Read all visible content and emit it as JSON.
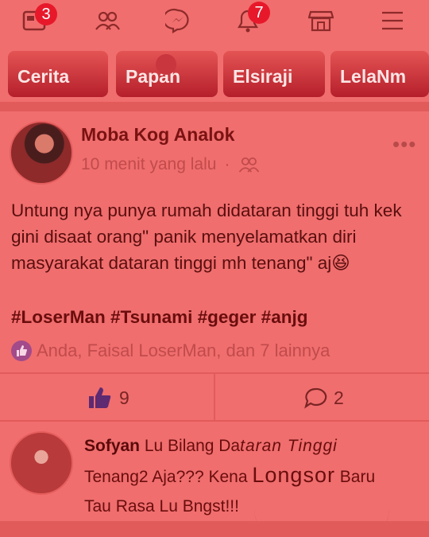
{
  "nav": {
    "items": [
      {
        "icon": "news-feed-icon",
        "badge": "3"
      },
      {
        "icon": "friends-icon",
        "badge": ""
      },
      {
        "icon": "messenger-icon",
        "badge": ""
      },
      {
        "icon": "bell-icon",
        "badge": "7"
      },
      {
        "icon": "marketplace-icon",
        "badge": ""
      },
      {
        "icon": "menu-icon",
        "badge": ""
      }
    ]
  },
  "stories": [
    {
      "label": "Cerita"
    },
    {
      "label": "Papah"
    },
    {
      "label": "Elsiraji"
    },
    {
      "label": "LelaNm"
    }
  ],
  "post": {
    "author": "Moba Kog Analok",
    "time": "10 menit yang lalu",
    "separator": "·",
    "privacy_icon": "friends-icon",
    "text": "Untung nya punya rumah didataran tinggi tuh kek gini disaat orang\" panik menyelamatkan diri masyarakat dataran tinggi mh tenang\" aj",
    "emoji": "😆",
    "hashtags": "#LoserMan #Tsunami #geger #anjg",
    "reactions_text": "Anda, Faisal LoserMan, dan 7 lainnya",
    "like_count": "9",
    "comment_count": "2"
  },
  "comment": {
    "author": "Sofyan",
    "text_parts": [
      "Lu Bilang Da",
      "taran Tinggi",
      "Tenang2 Aja??? Ke",
      "na",
      "Longsor",
      "Baru",
      "Tau Rasa Lu Bngst!!!"
    ]
  },
  "colors": {
    "background": "#f06e6e",
    "badge": "#e8182b",
    "text_dark": "#5a0e0e"
  }
}
